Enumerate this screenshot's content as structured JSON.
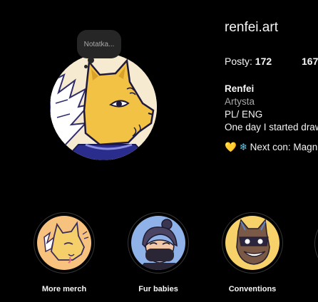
{
  "profile": {
    "note": "Notatka...",
    "username": "renfei.art",
    "stats": {
      "posts_label": "Posty:",
      "posts_value": "172",
      "followers_value": "167"
    },
    "bio": {
      "name": "Renfei",
      "category": "Artysta",
      "line1": "PL/ ENG",
      "line2": "One day I started drawing",
      "con_line": "Next con: Magnificon"
    }
  },
  "icons": {
    "heart": "yellow-heart-icon",
    "snowflake": "snowflake-icon"
  },
  "highlights": [
    {
      "label": "More merch",
      "bg": "#f7c17e"
    },
    {
      "label": "Fur babies",
      "bg": "#8fb2e8"
    },
    {
      "label": "Conventions",
      "bg": "#f7d26a"
    }
  ],
  "colors": {
    "background": "#000000",
    "text": "#f5f5f5",
    "muted": "#a8a8a8",
    "note_bg": "#262626"
  }
}
